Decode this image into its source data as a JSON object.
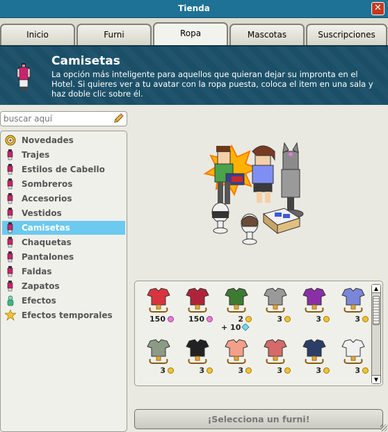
{
  "window": {
    "title": "Tienda",
    "close_label": "✕"
  },
  "tabs": [
    {
      "label": "Inicio",
      "active": false
    },
    {
      "label": "Furni",
      "active": false
    },
    {
      "label": "Ropa",
      "active": true
    },
    {
      "label": "Mascotas",
      "active": false
    },
    {
      "label": "Suscripciones",
      "active": false
    }
  ],
  "header": {
    "title": "Camisetas",
    "description": "La opción más inteligente para aquellos que quieran dejar su impronta en el Hotel. Si quieres ver a tu avatar con la ropa puesta, coloca el item en una sala y haz doble clic sobre él."
  },
  "search": {
    "placeholder": "buscar aquí"
  },
  "categories": [
    {
      "label": "Novedades",
      "icon": "target-icon"
    },
    {
      "label": "Trajes",
      "icon": "clothing-icon"
    },
    {
      "label": "Estilos de Cabello",
      "icon": "clothing-icon"
    },
    {
      "label": "Sombreros",
      "icon": "clothing-icon"
    },
    {
      "label": "Accesorios",
      "icon": "clothing-icon"
    },
    {
      "label": "Vestidos",
      "icon": "clothing-icon"
    },
    {
      "label": "Camisetas",
      "icon": "clothing-icon",
      "active": true
    },
    {
      "label": "Chaquetas",
      "icon": "clothing-icon"
    },
    {
      "label": "Pantalones",
      "icon": "clothing-icon"
    },
    {
      "label": "Faldas",
      "icon": "clothing-icon"
    },
    {
      "label": "Zapatos",
      "icon": "clothing-icon"
    },
    {
      "label": "Efectos",
      "icon": "effects-icon"
    },
    {
      "label": "Efectos temporales",
      "icon": "temporary-effects-icon"
    }
  ],
  "items": [
    {
      "name": "red-shirt",
      "price": "150",
      "currency": "pink",
      "color": "#d8343f"
    },
    {
      "name": "dark-red-jacket",
      "price": "150",
      "currency": "pink",
      "color": "#b0243a"
    },
    {
      "name": "green-bikini-top",
      "price": "2",
      "currency": "gold",
      "extra": "+ 10",
      "color": "#3d7a32"
    },
    {
      "name": "grey-hoodie",
      "price": "3",
      "currency": "gold",
      "color": "#9a9a9a"
    },
    {
      "name": "purple-top",
      "price": "3",
      "currency": "gold",
      "color": "#8a2fa6"
    },
    {
      "name": "blue-top",
      "price": "3",
      "currency": "gold",
      "color": "#7a86d8"
    },
    {
      "name": "camo-shirt",
      "price": "3",
      "currency": "gold",
      "color": "#8c9a88"
    },
    {
      "name": "black-bra",
      "price": "3",
      "currency": "gold",
      "color": "#222222"
    },
    {
      "name": "pink-shirt",
      "price": "3",
      "currency": "gold",
      "color": "#f2a08a"
    },
    {
      "name": "plaid-shirt",
      "price": "3",
      "currency": "gold",
      "color": "#d46a6a"
    },
    {
      "name": "navy-jacket",
      "price": "3",
      "currency": "gold",
      "color": "#2b3f66"
    },
    {
      "name": "white-shirt",
      "price": "3",
      "currency": "gold",
      "color": "#f0f0f0"
    }
  ],
  "footer": {
    "select_label": "¡Selecciona un furni!"
  },
  "colors": {
    "titlebar": "#1e7295",
    "header": "#1a4f67",
    "active_category": "#6cc9ef",
    "close_button": "#c63a1e"
  }
}
